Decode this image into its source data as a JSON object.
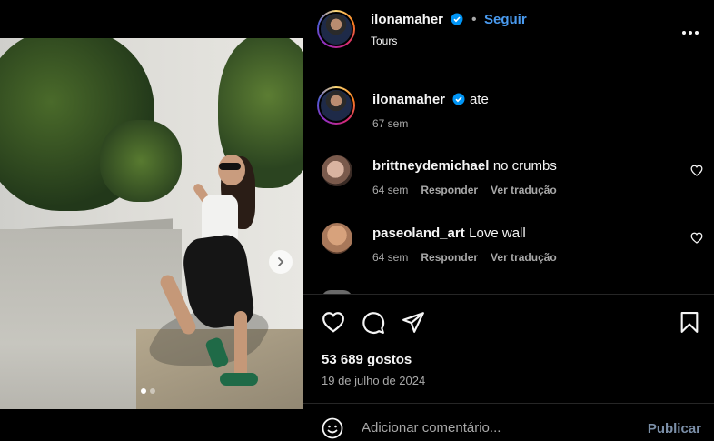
{
  "post": {
    "author": "ilonamaher",
    "verified": true,
    "follow_label": "Seguir",
    "separator": "•",
    "subtitle": "Tours"
  },
  "caption": {
    "author": "ilonamaher",
    "text": "ate",
    "time": "67 sem"
  },
  "comments": [
    {
      "author": "brittneydemichael",
      "text": "no crumbs",
      "time": "64 sem",
      "reply_label": "Responder",
      "translate_label": "Ver tradução"
    },
    {
      "author": "paseoland_art",
      "text": "Love wall",
      "time": "64 sem",
      "reply_label": "Responder",
      "translate_label": "Ver tradução"
    }
  ],
  "stats": {
    "likes": "53 689 gostos",
    "date": "19 de julho de 2024"
  },
  "composer": {
    "placeholder": "Adicionar comentário...",
    "publish_label": "Publicar"
  },
  "media": {
    "slides_total": 2,
    "active_slide": 1
  },
  "icons": {
    "like": "heart-icon",
    "comment": "comment-icon",
    "share": "share-icon",
    "save": "bookmark-icon",
    "more": "more-icon",
    "emoji": "emoji-icon",
    "next": "chevron-right-icon"
  },
  "colors": {
    "accent": "#4a9bf0",
    "background": "#000000",
    "muted": "#a8a8a8"
  }
}
